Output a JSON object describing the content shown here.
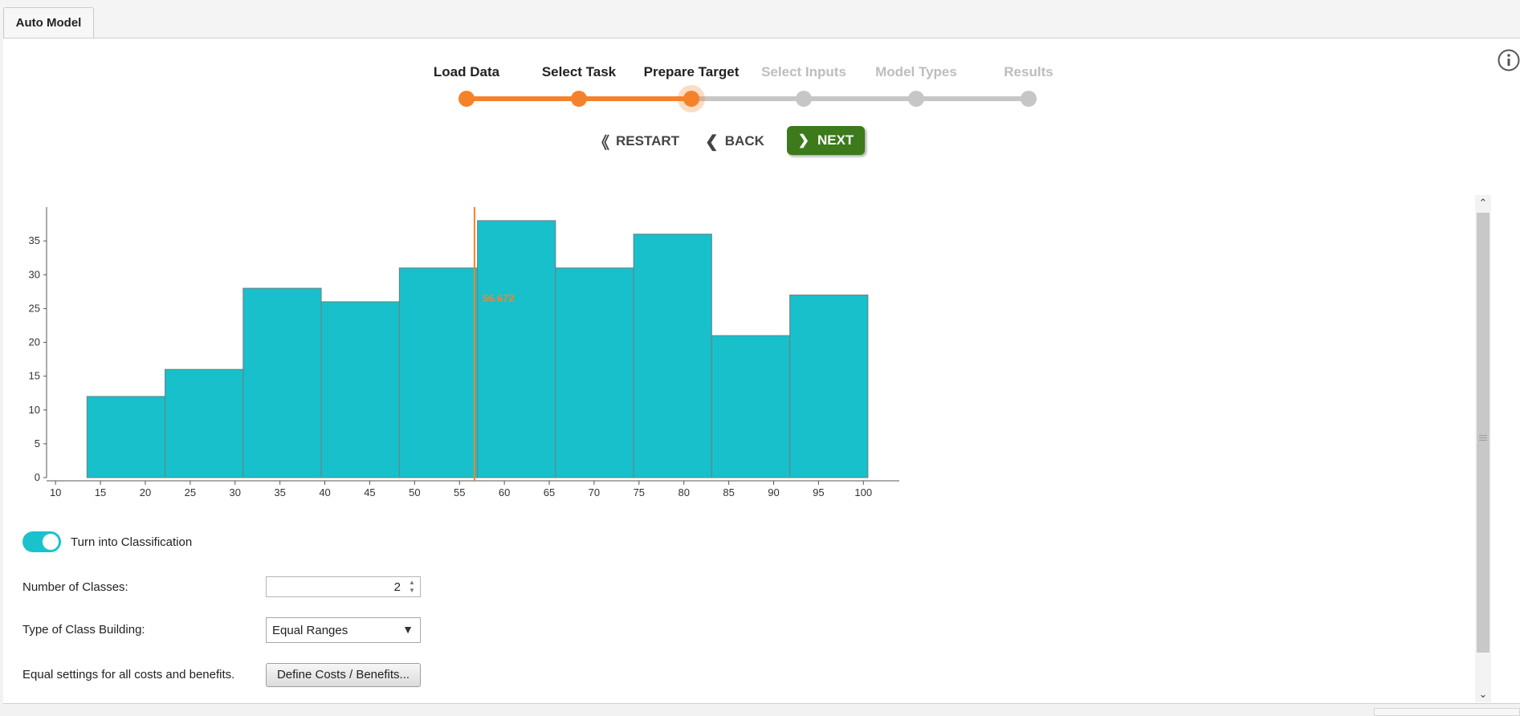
{
  "tab": {
    "label": "Auto Model"
  },
  "steps": [
    {
      "label": "Load Data",
      "state": "done"
    },
    {
      "label": "Select Task",
      "state": "done"
    },
    {
      "label": "Prepare Target",
      "state": "current"
    },
    {
      "label": "Select Inputs",
      "state": "todo"
    },
    {
      "label": "Model Types",
      "state": "todo"
    },
    {
      "label": "Results",
      "state": "todo"
    }
  ],
  "nav": {
    "restart": "RESTART",
    "back": "BACK",
    "next": "NEXT"
  },
  "colors": {
    "accent": "#f5822a",
    "bar": "#17c0cb",
    "next": "#3c7a1c",
    "inactive": "#c6c6c6"
  },
  "chart_data": {
    "type": "histogram",
    "bins": [
      {
        "start": 13.5,
        "end": 22.2,
        "count": 12
      },
      {
        "start": 22.2,
        "end": 30.9,
        "count": 16
      },
      {
        "start": 30.9,
        "end": 39.6,
        "count": 28
      },
      {
        "start": 39.6,
        "end": 48.3,
        "count": 26
      },
      {
        "start": 48.3,
        "end": 57.0,
        "count": 31
      },
      {
        "start": 57.0,
        "end": 65.7,
        "count": 38
      },
      {
        "start": 65.7,
        "end": 74.4,
        "count": 31
      },
      {
        "start": 74.4,
        "end": 83.1,
        "count": 36
      },
      {
        "start": 83.1,
        "end": 91.8,
        "count": 21
      },
      {
        "start": 91.8,
        "end": 100.5,
        "count": 27
      }
    ],
    "x_ticks": [
      10,
      15,
      20,
      25,
      30,
      35,
      40,
      45,
      50,
      55,
      60,
      65,
      70,
      75,
      80,
      85,
      90,
      95,
      100
    ],
    "y_ticks": [
      0,
      5,
      10,
      15,
      20,
      25,
      30,
      35
    ],
    "xlim": [
      9,
      104
    ],
    "ylim": [
      0,
      40
    ],
    "threshold": {
      "value": 56.672,
      "label": "56.672"
    }
  },
  "classification": {
    "toggle_label": "Turn into Classification",
    "toggle_on": true,
    "num_classes_label": "Number of Classes:",
    "num_classes_value": "2",
    "class_building_label": "Type of Class Building:",
    "class_building_value": "Equal Ranges",
    "costs_label": "Equal settings for all costs and benefits.",
    "costs_button": "Define Costs / Benefits..."
  }
}
